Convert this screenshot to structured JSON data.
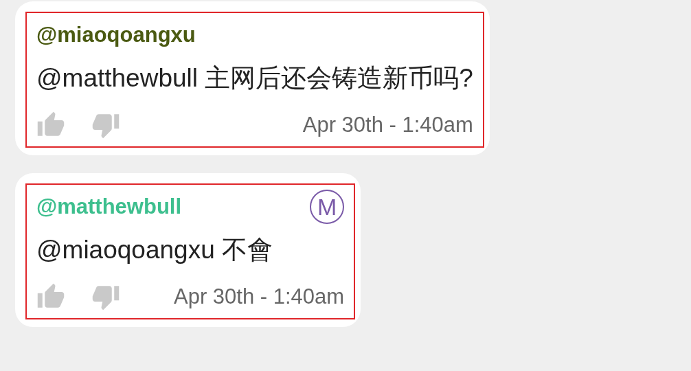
{
  "messages": [
    {
      "author": "@miaoqoangxu",
      "color": "#4b5a12",
      "text": "@matthewbull 主网后还会铸造新币吗?",
      "time": "Apr 30th - 1:40am",
      "highlighted": true
    },
    {
      "author": "@matthewbull",
      "color": "#3dbf8e",
      "badge": "M",
      "text": "@miaoqoangxu 不會",
      "time": "Apr 30th - 1:40am",
      "highlighted": true
    }
  ]
}
